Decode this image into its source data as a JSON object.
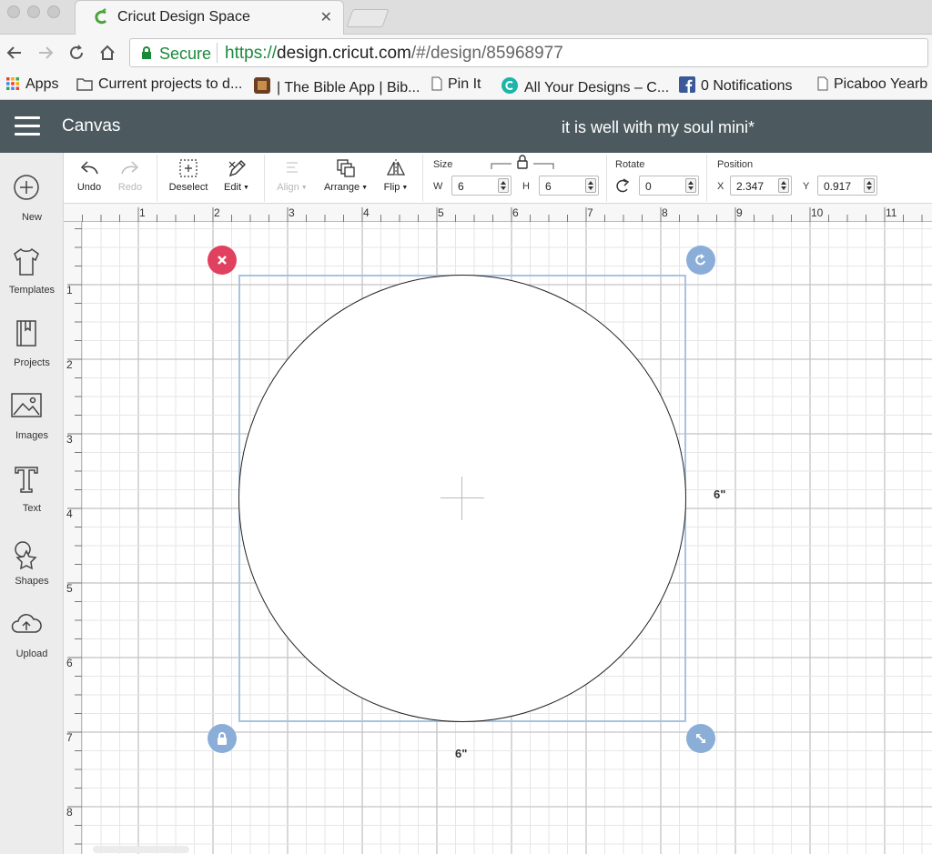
{
  "browser": {
    "tab_title": "Cricut Design Space",
    "tab_close": "✕",
    "secure_label": "Secure",
    "url_scheme": "https://",
    "url_host": "design.cricut.com",
    "url_rest": "/#/design/85968977",
    "bookmarks": [
      {
        "label": "Apps",
        "icon": "apps-grid-icon"
      },
      {
        "label": "Current projects to d...",
        "icon": "folder-icon"
      },
      {
        "label": "| The Bible App | Bib...",
        "icon": "bible-app-icon"
      },
      {
        "label": "Pin It",
        "icon": "page-icon"
      },
      {
        "label": "All Your Designs – C...",
        "icon": "cricut-icon"
      },
      {
        "label": "0 Notifications",
        "icon": "facebook-icon"
      },
      {
        "label": "Picaboo Yearb",
        "icon": "page-icon"
      }
    ]
  },
  "header": {
    "section_title": "Canvas",
    "project_title": "it is well with my soul mini*",
    "bar_color": "#4c5a60"
  },
  "sidebar": {
    "items": [
      {
        "label": "New",
        "icon": "plus-circle-icon"
      },
      {
        "label": "Templates",
        "icon": "tshirt-icon"
      },
      {
        "label": "Projects",
        "icon": "notebook-icon"
      },
      {
        "label": "Images",
        "icon": "image-icon"
      },
      {
        "label": "Text",
        "icon": "text-t-icon"
      },
      {
        "label": "Shapes",
        "icon": "shapes-icon"
      },
      {
        "label": "Upload",
        "icon": "cloud-upload-icon"
      }
    ]
  },
  "toolbar": {
    "undo": "Undo",
    "redo": "Redo",
    "deselect": "Deselect",
    "edit": "Edit",
    "align": "Align",
    "arrange": "Arrange",
    "flip": "Flip",
    "size": {
      "title": "Size",
      "w_label": "W",
      "w_value": "6",
      "h_label": "H",
      "h_value": "6"
    },
    "rotate": {
      "title": "Rotate",
      "value": "0"
    },
    "position": {
      "title": "Position",
      "x_label": "X",
      "x_value": "2.347",
      "y_label": "Y",
      "y_value": "0.917"
    }
  },
  "canvas": {
    "ruler_top": [
      "1",
      "2",
      "3",
      "4",
      "5",
      "6",
      "7",
      "8",
      "9",
      "10",
      "11"
    ],
    "ruler_left": [
      "1",
      "2",
      "3",
      "4",
      "5",
      "6",
      "7",
      "8"
    ],
    "width_label": "6\"",
    "height_label": "6\"",
    "handle_colors": {
      "delete": "#e0415e",
      "other": "#8aaed8"
    }
  }
}
